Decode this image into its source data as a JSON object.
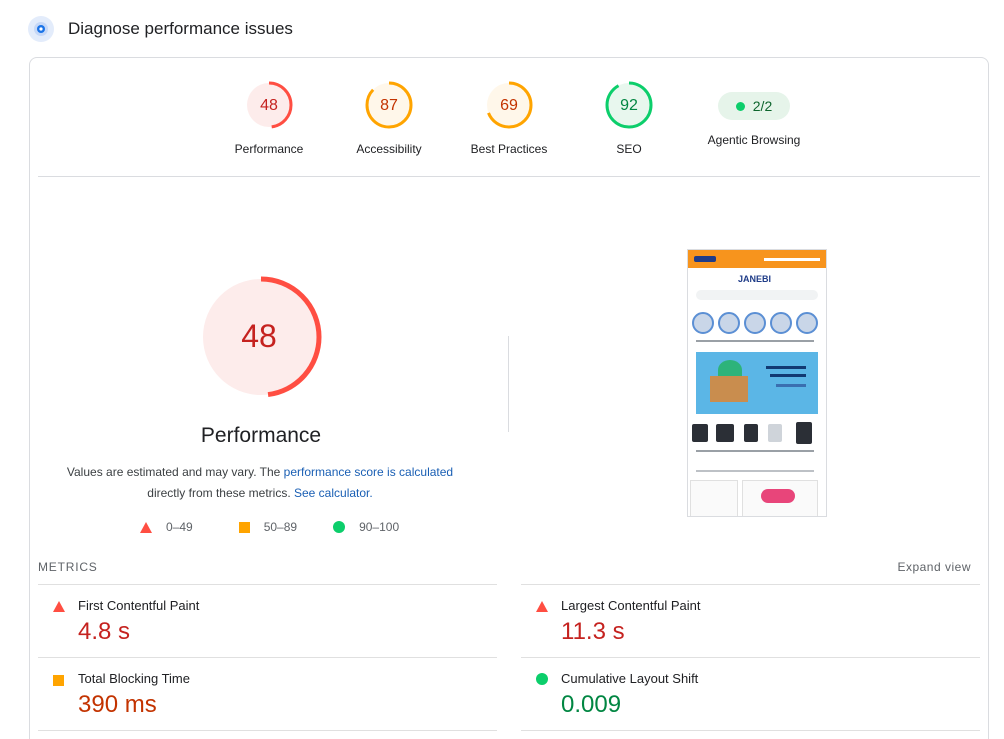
{
  "header": {
    "title": "Diagnose performance issues",
    "icon": "speedometer-icon"
  },
  "scores": [
    {
      "label": "Performance",
      "value": "48",
      "score": 48,
      "color": "#ff4e42",
      "fill": "#fdeceb",
      "text_color": "#c5221f"
    },
    {
      "label": "Accessibility",
      "value": "87",
      "score": 87,
      "color": "#ffa400",
      "fill": "#fff7ea",
      "text_color": "#c33300"
    },
    {
      "label": "Best Practices",
      "value": "69",
      "score": 69,
      "color": "#ffa400",
      "fill": "#fff7ea",
      "text_color": "#c33300"
    },
    {
      "label": "SEO",
      "value": "92",
      "score": 92,
      "color": "#0cce6b",
      "fill": "#e8f7ee",
      "text_color": "#018642"
    }
  ],
  "agentic": {
    "label": "Agentic Browsing",
    "value": "2/2"
  },
  "main": {
    "score": "48",
    "title": "Performance",
    "desc_prefix": "Values are estimated and may vary. The ",
    "desc_link1": "performance score is calculated",
    "desc_middle": "directly from these metrics.",
    "desc_link2": "See calculator."
  },
  "legend": {
    "red": "0–49",
    "orange": "50–89",
    "green": "90–100"
  },
  "metrics_heading": "METRICS",
  "expand_label": "Expand view",
  "metrics": [
    {
      "name": "First Contentful Paint",
      "value": "4.8 s",
      "status": "red"
    },
    {
      "name": "Largest Contentful Paint",
      "value": "11.3 s",
      "status": "red"
    },
    {
      "name": "Total Blocking Time",
      "value": "390 ms",
      "status": "orange"
    },
    {
      "name": "Cumulative Layout Shift",
      "value": "0.009",
      "status": "green"
    }
  ],
  "screenshot": {
    "brand": "JANEBI"
  }
}
